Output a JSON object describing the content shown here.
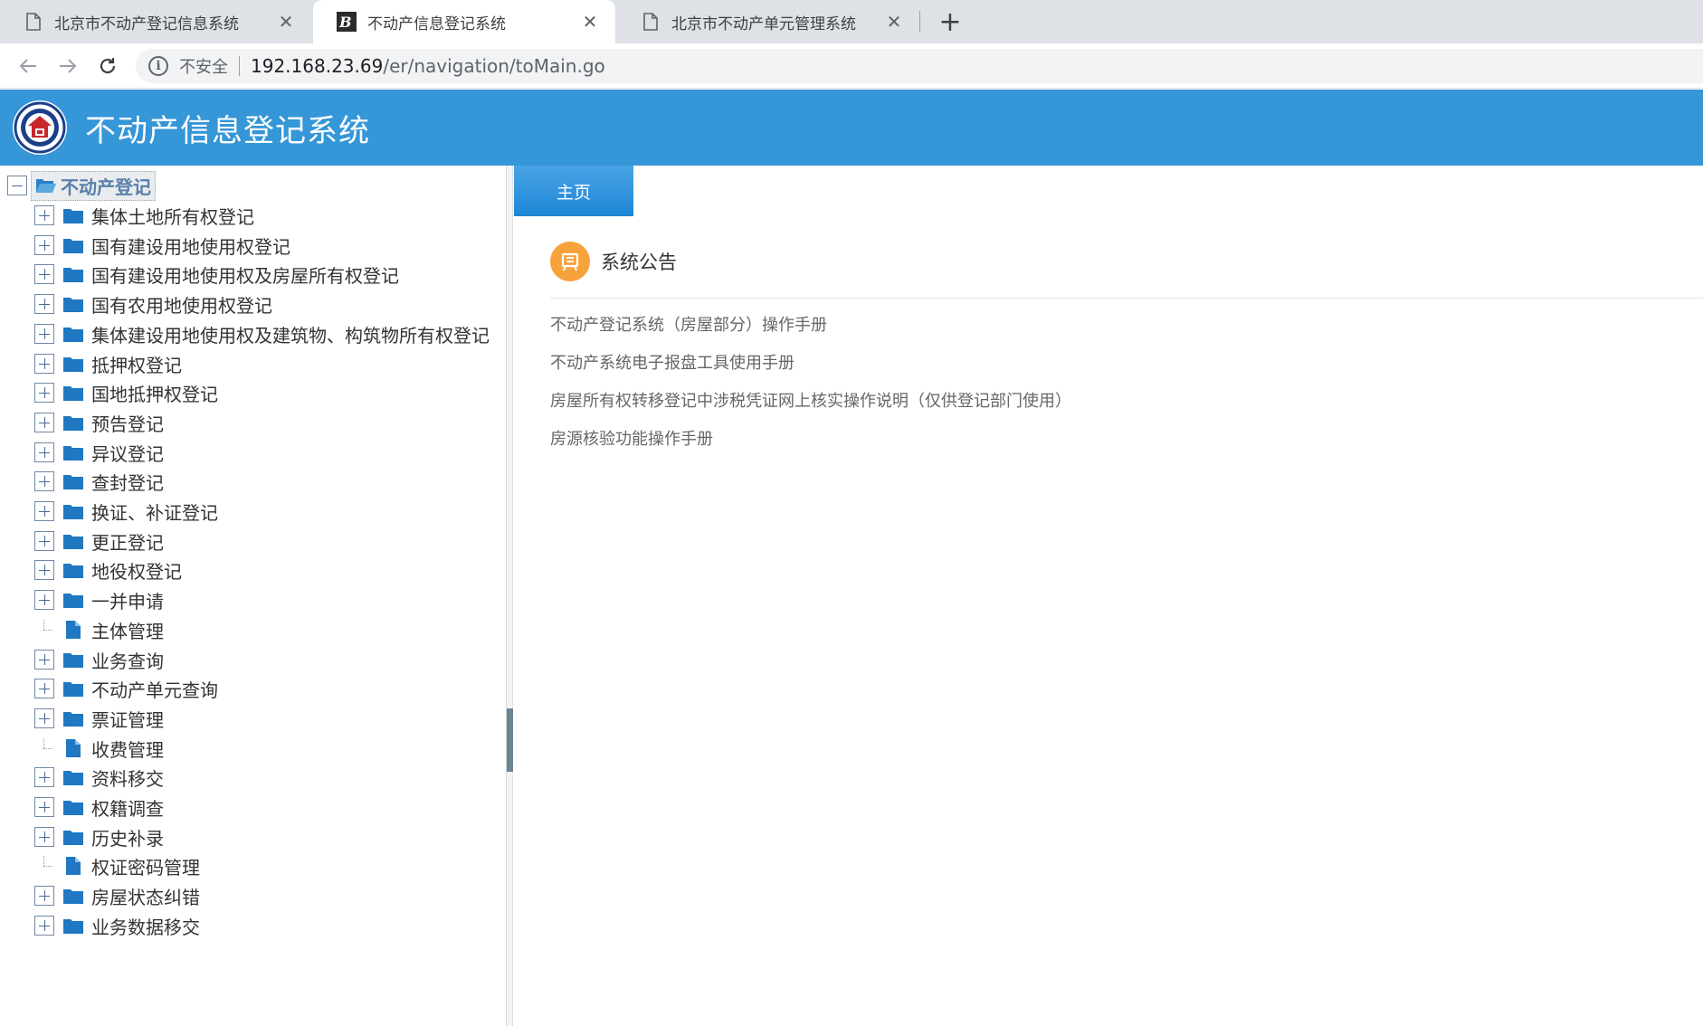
{
  "browser": {
    "tabs": [
      {
        "title": "北京市不动产登记信息系统",
        "active": false,
        "icon": "document-icon"
      },
      {
        "title": "不动产信息登记系统",
        "active": true,
        "icon": "site-favicon-icon"
      },
      {
        "title": "北京市不动产单元管理系统",
        "active": false,
        "icon": "document-icon"
      }
    ],
    "close_glyph": "✕",
    "new_tab_glyph": "+",
    "security_label": "不安全",
    "url_host": "192.168.23.69",
    "url_path": "/er/navigation/toMain.go"
  },
  "header": {
    "title": "不动产信息登记系统",
    "accent_color": "#3596d8"
  },
  "tree": {
    "root": "不动产登记",
    "items": [
      {
        "label": "集体土地所有权登记",
        "type": "folder"
      },
      {
        "label": "国有建设用地使用权登记",
        "type": "folder"
      },
      {
        "label": "国有建设用地使用权及房屋所有权登记",
        "type": "folder"
      },
      {
        "label": "国有农用地使用权登记",
        "type": "folder"
      },
      {
        "label": "集体建设用地使用权及建筑物、构筑物所有权登记",
        "type": "folder"
      },
      {
        "label": "抵押权登记",
        "type": "folder"
      },
      {
        "label": "国地抵押权登记",
        "type": "folder"
      },
      {
        "label": "预告登记",
        "type": "folder"
      },
      {
        "label": "异议登记",
        "type": "folder"
      },
      {
        "label": "查封登记",
        "type": "folder"
      },
      {
        "label": "换证、补证登记",
        "type": "folder"
      },
      {
        "label": "更正登记",
        "type": "folder"
      },
      {
        "label": "地役权登记",
        "type": "folder"
      },
      {
        "label": "一并申请",
        "type": "folder"
      },
      {
        "label": "主体管理",
        "type": "file"
      },
      {
        "label": "业务查询",
        "type": "folder"
      },
      {
        "label": "不动产单元查询",
        "type": "folder"
      },
      {
        "label": "票证管理",
        "type": "folder"
      },
      {
        "label": "收费管理",
        "type": "file"
      },
      {
        "label": "资料移交",
        "type": "folder"
      },
      {
        "label": "权籍调查",
        "type": "folder"
      },
      {
        "label": "历史补录",
        "type": "folder"
      },
      {
        "label": "权证密码管理",
        "type": "file"
      },
      {
        "label": "房屋状态纠错",
        "type": "folder"
      },
      {
        "label": "业务数据移交",
        "type": "folder"
      }
    ]
  },
  "main": {
    "tab_label": "主页",
    "notice_title": "系统公告",
    "notices": [
      "不动产登记系统（房屋部分）操作手册",
      "不动产系统电子报盘工具使用手册",
      "房屋所有权转移登记中涉税凭证网上核实操作说明（仅供登记部门使用）",
      "房源核验功能操作手册"
    ]
  }
}
